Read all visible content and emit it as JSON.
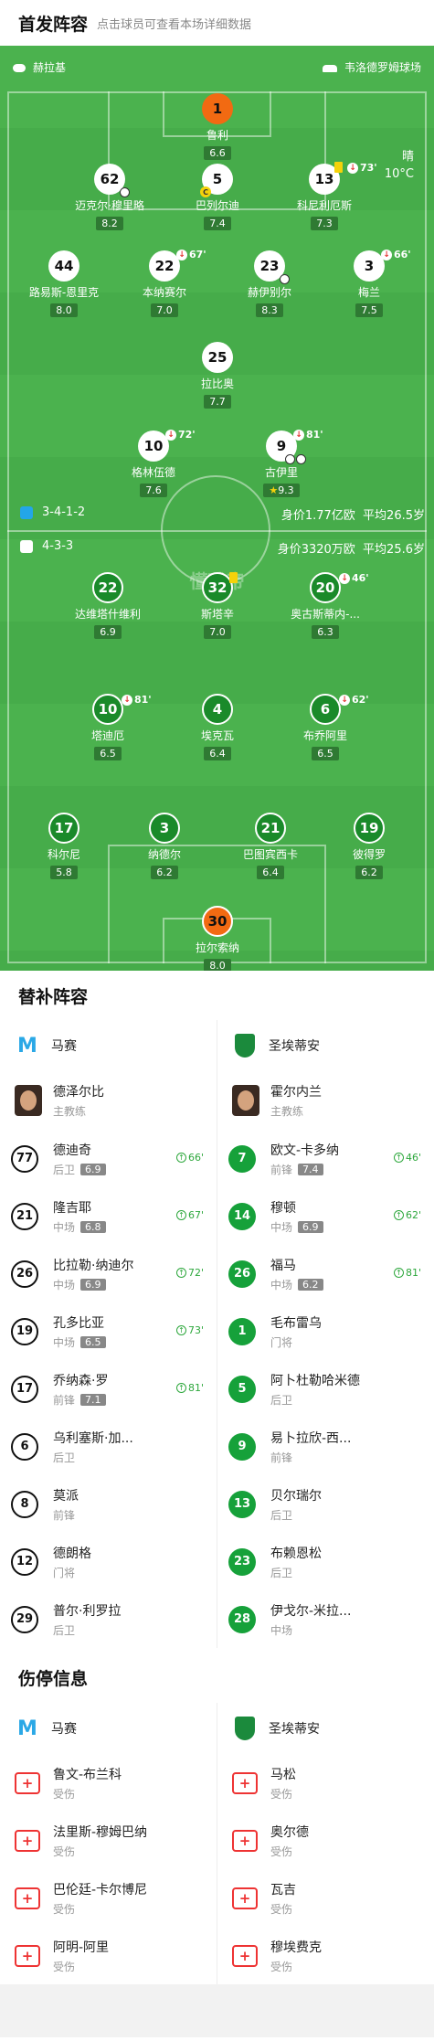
{
  "lineup": {
    "title": "首发阵容",
    "subtitle": "点击球员可查看本场详细数据"
  },
  "pitch": {
    "home_team": "赫拉基",
    "stadium": "韦洛德罗姆球场",
    "weather": "晴",
    "temperature": "10°C",
    "watermark": "懂球帝",
    "home_formation": "3-4-1-2",
    "home_value": "身价1.77亿欧",
    "home_age": "平均26.5岁",
    "away_formation": "4-3-3",
    "away_value": "身价3320万欧",
    "away_age": "平均25.6岁"
  },
  "home_players": [
    {
      "num": "1",
      "name": "鲁利",
      "rating": "6.6",
      "style": "o"
    },
    {
      "num": "62",
      "name": "迈克尔·穆里略",
      "rating": "8.2",
      "style": "w"
    },
    {
      "num": "5",
      "name": "巴列尔迪",
      "rating": "7.4",
      "style": "w"
    },
    {
      "num": "13",
      "name": "科尼利厄斯",
      "rating": "7.3",
      "style": "w",
      "sub_min": "73'"
    },
    {
      "num": "44",
      "name": "路易斯-恩里克",
      "rating": "8.0",
      "style": "w"
    },
    {
      "num": "22",
      "name": "本纳赛尔",
      "rating": "7.0",
      "style": "w",
      "sub_min": "67'"
    },
    {
      "num": "23",
      "name": "赫伊别尔",
      "rating": "8.3",
      "style": "w"
    },
    {
      "num": "3",
      "name": "梅兰",
      "rating": "7.5",
      "style": "w",
      "sub_min": "66'"
    },
    {
      "num": "25",
      "name": "拉比奥",
      "rating": "7.7",
      "style": "w"
    },
    {
      "num": "10",
      "name": "格林伍德",
      "rating": "7.6",
      "style": "w",
      "sub_min": "72'"
    },
    {
      "num": "9",
      "name": "古伊里",
      "rating": "9.3",
      "style": "w",
      "sub_min": "81'"
    }
  ],
  "away_players": [
    {
      "num": "22",
      "name": "达维塔什维利",
      "rating": "6.9",
      "style": "g"
    },
    {
      "num": "32",
      "name": "斯塔辛",
      "rating": "7.0",
      "style": "g"
    },
    {
      "num": "20",
      "name": "奥古斯蒂内-...",
      "rating": "6.3",
      "style": "g",
      "sub_min": "46'"
    },
    {
      "num": "10",
      "name": "塔迪厄",
      "rating": "6.5",
      "style": "g",
      "sub_min": "81'"
    },
    {
      "num": "4",
      "name": "埃克瓦",
      "rating": "6.4",
      "style": "g"
    },
    {
      "num": "6",
      "name": "布乔阿里",
      "rating": "6.5",
      "style": "g",
      "sub_min": "62'"
    },
    {
      "num": "17",
      "name": "科尔尼",
      "rating": "5.8",
      "style": "g"
    },
    {
      "num": "3",
      "name": "纳德尔",
      "rating": "6.2",
      "style": "g"
    },
    {
      "num": "21",
      "name": "巴图宾西卡",
      "rating": "6.4",
      "style": "g"
    },
    {
      "num": "19",
      "name": "彼得罗",
      "rating": "6.2",
      "style": "g"
    },
    {
      "num": "30",
      "name": "拉尔索纳",
      "rating": "8.0",
      "style": "og"
    }
  ],
  "subs": {
    "title": "替补阵容",
    "home": {
      "team": "马赛",
      "coach": "德泽尔比",
      "coach_role": "主教练",
      "list": [
        {
          "num": "77",
          "name": "德迪奇",
          "pos": "后卫",
          "rating": "6.9",
          "in": "66'"
        },
        {
          "num": "21",
          "name": "隆吉耶",
          "pos": "中场",
          "rating": "6.8",
          "in": "67'"
        },
        {
          "num": "26",
          "name": "比拉勒·纳迪尔",
          "pos": "中场",
          "rating": "6.9",
          "in": "72'"
        },
        {
          "num": "19",
          "name": "孔多比亚",
          "pos": "中场",
          "rating": "6.5",
          "in": "73'"
        },
        {
          "num": "17",
          "name": "乔纳森·罗",
          "pos": "前锋",
          "rating": "7.1",
          "in": "81'"
        },
        {
          "num": "6",
          "name": "乌利塞斯·加...",
          "pos": "后卫"
        },
        {
          "num": "8",
          "name": "莫派",
          "pos": "前锋"
        },
        {
          "num": "12",
          "name": "德朗格",
          "pos": "门将"
        },
        {
          "num": "29",
          "name": "普尔·利罗拉",
          "pos": "后卫"
        }
      ]
    },
    "away": {
      "team": "圣埃蒂安",
      "coach": "霍尔内兰",
      "coach_role": "主教练",
      "list": [
        {
          "num": "7",
          "name": "欧文-卡多纳",
          "pos": "前锋",
          "rating": "7.4",
          "in": "46'"
        },
        {
          "num": "14",
          "name": "穆顿",
          "pos": "中场",
          "rating": "6.9",
          "in": "62'"
        },
        {
          "num": "26",
          "name": "福马",
          "pos": "中场",
          "rating": "6.2",
          "in": "81'"
        },
        {
          "num": "1",
          "name": "毛布雷乌",
          "pos": "门将"
        },
        {
          "num": "5",
          "name": "阿卜杜勒哈米德",
          "pos": "后卫"
        },
        {
          "num": "9",
          "name": "易卜拉欣-西...",
          "pos": "前锋"
        },
        {
          "num": "13",
          "name": "贝尔瑞尔",
          "pos": "后卫"
        },
        {
          "num": "23",
          "name": "布赖恩松",
          "pos": "后卫"
        },
        {
          "num": "28",
          "name": "伊戈尔-米拉...",
          "pos": "中场"
        }
      ]
    }
  },
  "injuries": {
    "title": "伤停信息",
    "home": {
      "team": "马赛",
      "list": [
        {
          "name": "鲁文-布兰科",
          "status": "受伤"
        },
        {
          "name": "法里斯-穆姆巴纳",
          "status": "受伤"
        },
        {
          "name": "巴伦廷-卡尔博尼",
          "status": "受伤"
        },
        {
          "name": "阿明-阿里",
          "status": "受伤"
        }
      ]
    },
    "away": {
      "team": "圣埃蒂安",
      "list": [
        {
          "name": "马松",
          "status": "受伤"
        },
        {
          "name": "奥尔德",
          "status": "受伤"
        },
        {
          "name": "瓦吉",
          "status": "受伤"
        },
        {
          "name": "穆埃费克",
          "status": "受伤"
        }
      ]
    }
  }
}
